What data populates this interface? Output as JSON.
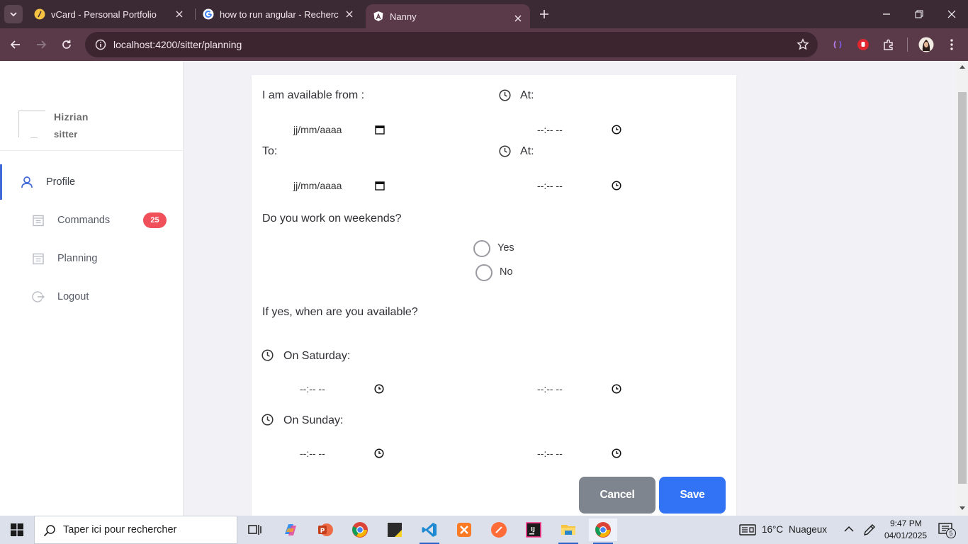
{
  "browser": {
    "tabs": [
      {
        "title": "vCard - Personal Portfolio",
        "favicon": "vcard-favicon-icon"
      },
      {
        "title": "how to run angular - Recherche",
        "favicon": "google-favicon-icon"
      },
      {
        "title": "Nanny",
        "favicon": "angular-favicon-icon"
      }
    ],
    "url": "localhost:4200/sitter/planning"
  },
  "sidebar": {
    "user_name": "Hizrian",
    "user_role": "sitter",
    "items": [
      {
        "label": "Profile",
        "icon": "user-icon",
        "active": true
      },
      {
        "label": "Commands",
        "icon": "calendar-icon",
        "badge": "25"
      },
      {
        "label": "Planning",
        "icon": "calendar-icon"
      },
      {
        "label": "Logout",
        "icon": "logout-icon"
      }
    ]
  },
  "form": {
    "available_from_label": "I am available from :",
    "at_label": "At:",
    "to_label": "To:",
    "date_placeholder": "jj/mm/aaaa",
    "time_placeholder": "--:-- --",
    "weekends_question": "Do you work on weekends?",
    "yes_label": "Yes",
    "no_label": "No",
    "if_yes_question": "If yes, when are you available?",
    "saturday_label": "On Saturday:",
    "sunday_label": "On Sunday:",
    "cancel_label": "Cancel",
    "save_label": "Save"
  },
  "taskbar": {
    "search_placeholder": "Taper ici pour rechercher",
    "weather_temp": "16°C",
    "weather_desc": "Nuageux",
    "time": "9:47 PM",
    "date": "04/01/2025",
    "notification_count": "5"
  },
  "colors": {
    "accent": "#3273f5",
    "badge": "#f0505a",
    "cancel": "#7f858e",
    "chrome_dark": "#3b2a33",
    "chrome_toolbar": "#5a3a48"
  }
}
